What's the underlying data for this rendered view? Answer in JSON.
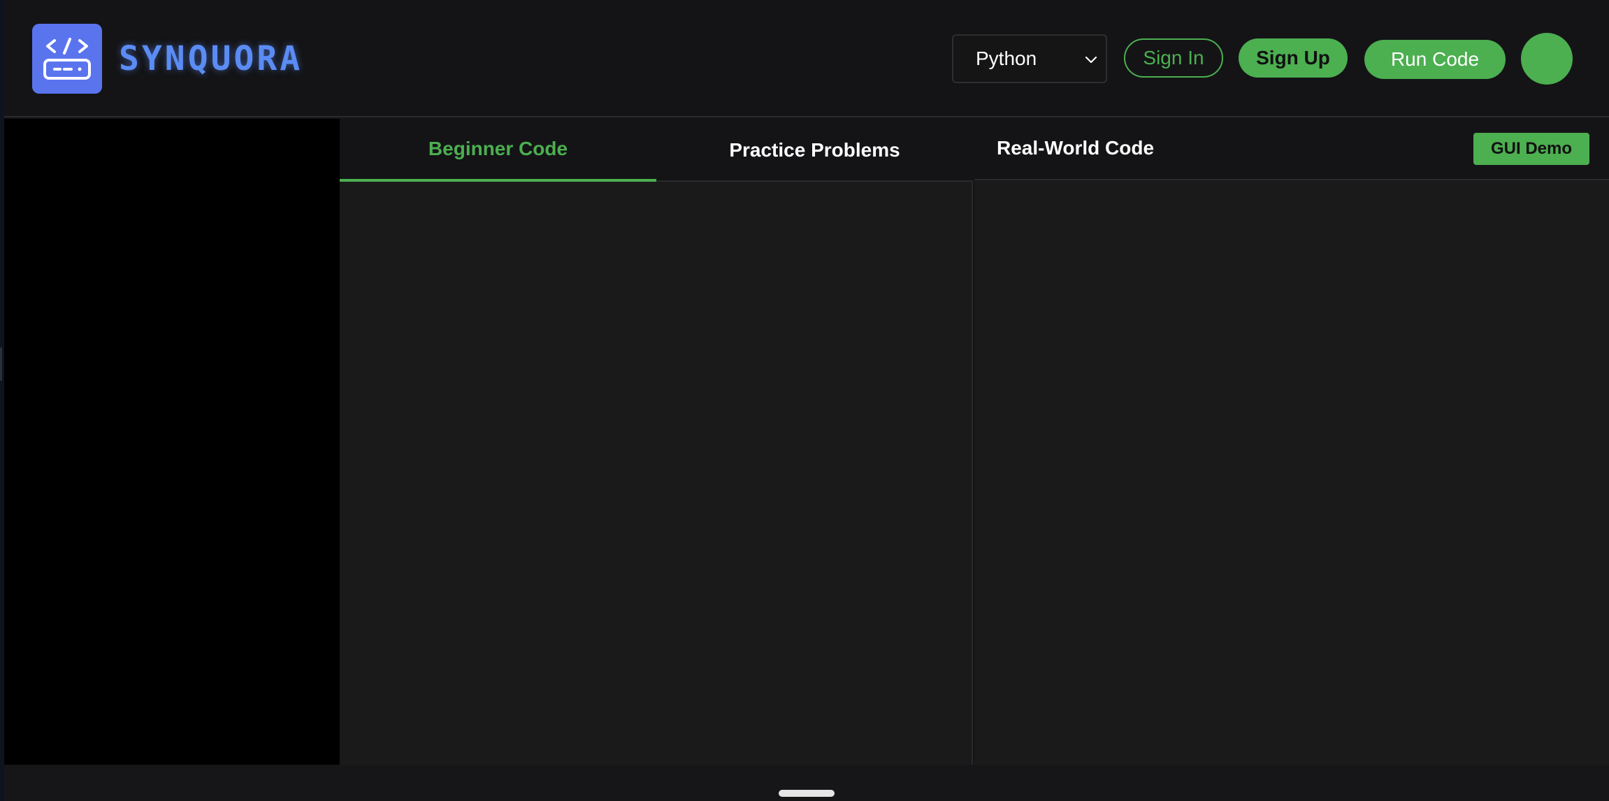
{
  "header": {
    "brand": "SYNQUORA",
    "language_select": {
      "value": "Python"
    },
    "sign_in_label": "Sign In",
    "sign_up_label": "Sign Up",
    "run_code_label": "Run Code"
  },
  "center": {
    "tabs": [
      {
        "label": "Beginner Code",
        "active": true
      },
      {
        "label": "Practice Problems",
        "active": false
      }
    ]
  },
  "right": {
    "title": "Real-World Code",
    "gui_demo_label": "GUI Demo"
  },
  "colors": {
    "accent": "#4caf50",
    "brand": "#5b8cf5",
    "logo_bg": "#5a74ee",
    "background": "#141416",
    "panel": "#1a1a1a",
    "sidebar": "#000000"
  },
  "icons": {
    "logo": "code-device-icon",
    "dropdown": "chevron-down-icon"
  }
}
